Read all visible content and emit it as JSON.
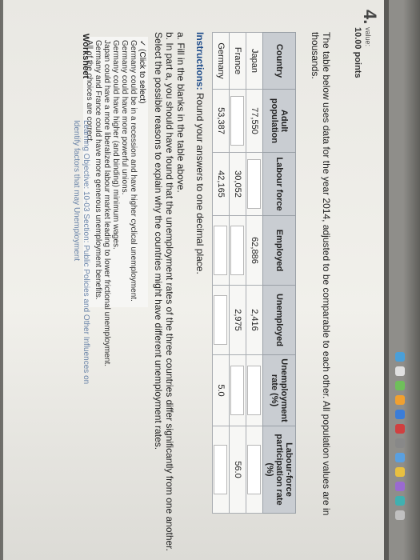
{
  "question": {
    "number": "4.",
    "value_label": "value:",
    "points": "10.00 points"
  },
  "intro": "The table below uses data for the year 2014, adjusted to be comparable to each other. All population values are in thousands.",
  "table": {
    "headers": [
      "Country",
      "Adult population",
      "Labour force",
      "Employed",
      "Unemployed",
      "Unemployment rate (%)",
      "Labour-force participation rate (%)"
    ],
    "rows": [
      {
        "country": "Japan",
        "adult_population": "77,550",
        "labour_force": "",
        "employed": "62,886",
        "unemployed": "2,416",
        "unemployment_rate": "",
        "participation_rate": ""
      },
      {
        "country": "France",
        "adult_population": "",
        "labour_force": "30,052",
        "employed": "",
        "unemployed": "2,975",
        "unemployment_rate": "",
        "participation_rate": "56.0"
      },
      {
        "country": "Germany",
        "adult_population": "53,387",
        "labour_force": "42,165",
        "employed": "",
        "unemployed": "",
        "unemployment_rate": "5.0",
        "participation_rate": ""
      }
    ]
  },
  "instructions": {
    "label": "Instructions:",
    "text": "Round your answers to one decimal place."
  },
  "parts": {
    "a": "a. Fill in the blanks in the table above.",
    "b": "b. In part a, you should have found that the unemployment rates of the three countries differ significantly from one another. Select the possible reasons to explain why the countries might have different unemployment rates."
  },
  "dropdown": {
    "selected": "(Click to select)",
    "options": [
      "Germany could be in a recession and have higher cyclical unemployment.",
      "Germany could have more powerful unions.",
      "Germany could have higher (and binding) minimum wages.",
      "Japan could have a more liberalized labour market leading to lower frictional unemployment.",
      "Germany and France could have more generous unemployment benefits.",
      "All of the choices are correct."
    ]
  },
  "footer": {
    "worksheet": "Worksheet",
    "learning": "Learning Objective: 10-03 Section: Public Policies and Other Influences on",
    "learning2": "Identify factors that may",
    "learning3": "Unemployment"
  },
  "colors": {
    "header_bg": "#c9cdd2",
    "instructions_accent": "#1e4c8a",
    "link": "#6a84a8"
  }
}
